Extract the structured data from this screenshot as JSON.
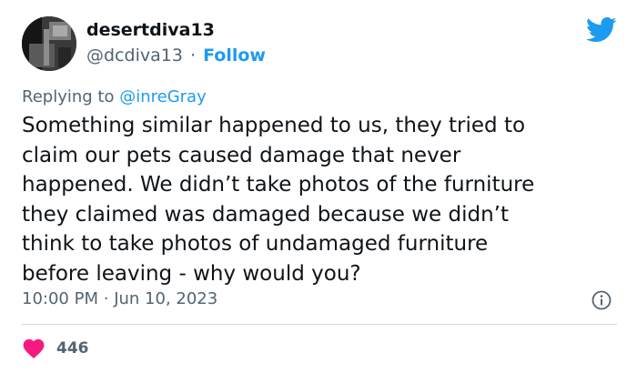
{
  "author": {
    "display_name": "desertdiva13",
    "handle": "@dcdiva13",
    "separator": "·",
    "follow_label": "Follow"
  },
  "reply": {
    "prefix": "Replying to",
    "target": "@inreGray"
  },
  "tweet": {
    "lines": [
      "Something similar happened to us, they tried to",
      "claim our pets caused damage that never",
      "happened. We didn’t take photos of the furniture",
      "they claimed was damaged because we didn’t",
      "think to take photos of undamaged furniture",
      "before leaving - why would you?"
    ],
    "time": "10:00 PM",
    "separator": "·",
    "date": "Jun 10, 2023"
  },
  "engagement": {
    "likes": "446"
  },
  "icons": {
    "brand": "twitter-bird-icon",
    "info": "info-icon",
    "like": "heart-icon"
  },
  "colors": {
    "accent": "#1d9bf0",
    "like": "#f91880",
    "text": "#0f1419",
    "muted": "#536471",
    "divider": "#cfd9de"
  }
}
